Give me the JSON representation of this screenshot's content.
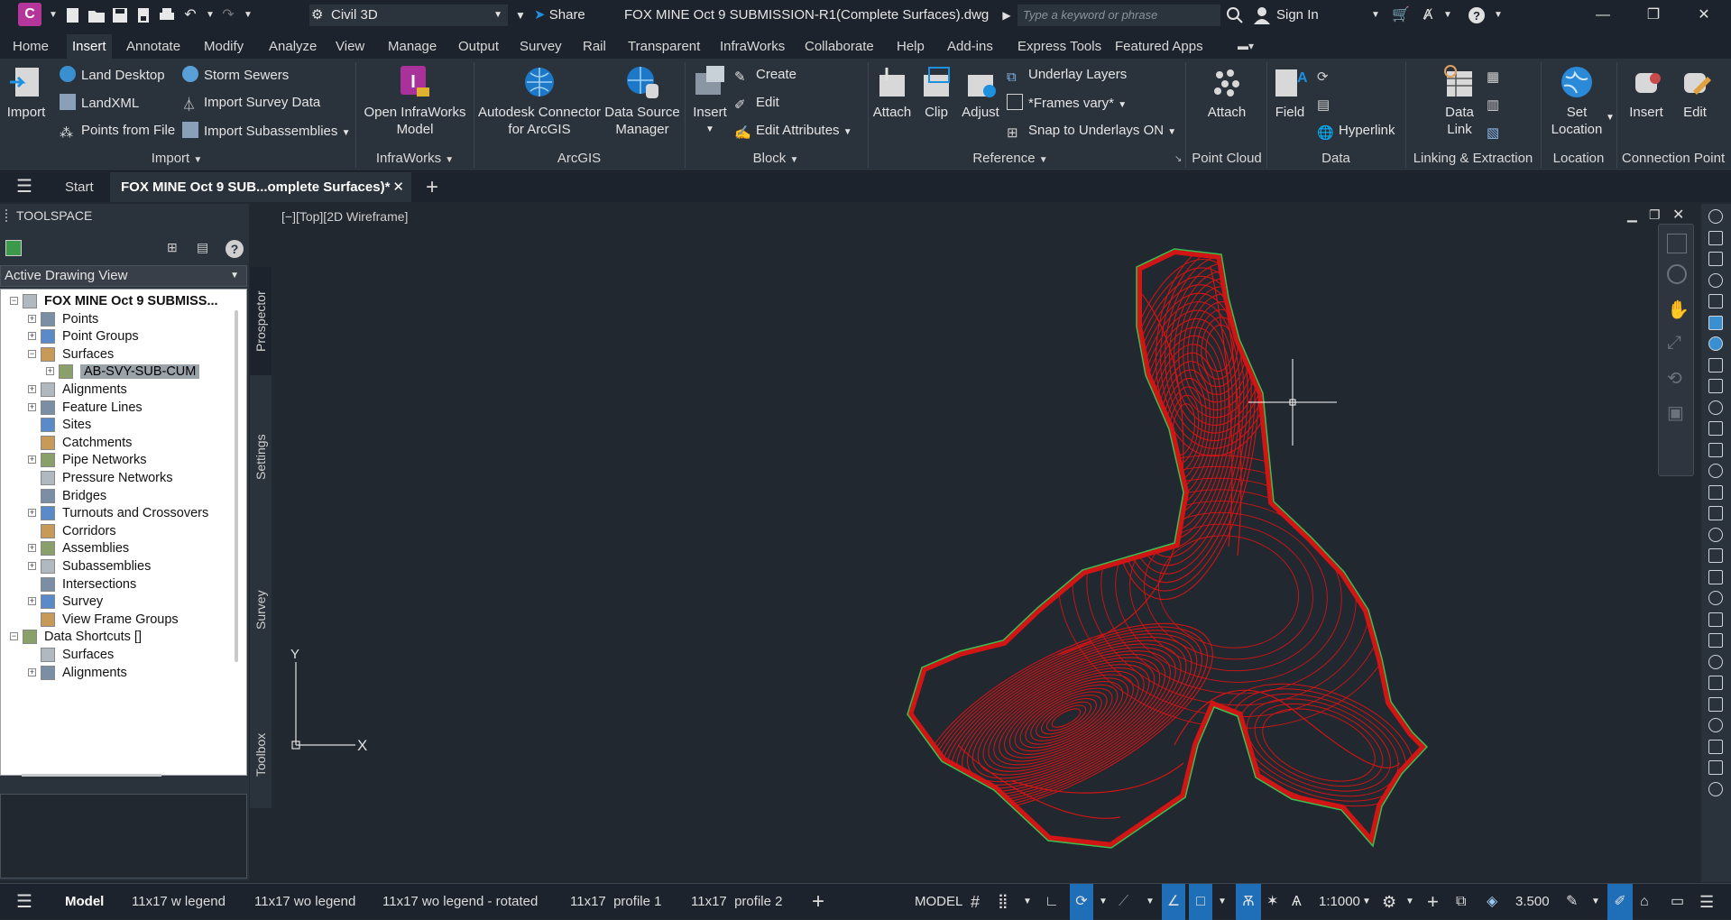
{
  "titlebar": {
    "app_letter": "C",
    "workspace": "Civil 3D",
    "share": "Share",
    "document_title": "FOX MINE Oct 9 SUBMISSION-R1(Complete Surfaces).dwg",
    "search_placeholder": "Type a keyword or phrase",
    "sign_in": "Sign In"
  },
  "menu": {
    "tabs": [
      "Home",
      "Insert",
      "Annotate",
      "Modify",
      "Analyze",
      "View",
      "Manage",
      "Output",
      "Survey",
      "Rail",
      "Transparent",
      "InfraWorks",
      "Collaborate",
      "Help",
      "Add-ins",
      "Express Tools",
      "Featured Apps"
    ],
    "active": "Insert"
  },
  "ribbon": {
    "import": {
      "title": "Import",
      "large": "Import",
      "items": [
        "Land Desktop",
        "LandXML",
        "Points from File",
        "Storm Sewers",
        "Import Survey Data",
        "Import Subassemblies"
      ]
    },
    "infraworks": {
      "title": "InfraWorks",
      "large_line1": "Open InfraWorks",
      "large_line2": "Model"
    },
    "arcgis": {
      "title": "ArcGIS",
      "connector_line1": "Autodesk Connector",
      "connector_line2": "for ArcGIS",
      "dsm_line1": "Data Source",
      "dsm_line2": "Manager"
    },
    "block": {
      "title": "Block",
      "large": "Insert",
      "items": [
        "Create",
        "Edit",
        "Edit Attributes"
      ]
    },
    "reference": {
      "title": "Reference",
      "attach": "Attach",
      "clip": "Clip",
      "adjust": "Adjust",
      "items": [
        "Underlay Layers",
        "*Frames vary*",
        "Snap to Underlays ON"
      ]
    },
    "pointcloud": {
      "title": "Point Cloud",
      "attach": "Attach"
    },
    "data": {
      "title": "Data",
      "field": "Field",
      "hyperlink": "Hyperlink"
    },
    "linking": {
      "title": "Linking & Extraction",
      "line1": "Data",
      "line2": "Link"
    },
    "location": {
      "title": "Location",
      "line1": "Set",
      "line2": "Location"
    },
    "connection": {
      "title": "Connection Point",
      "insert": "Insert",
      "edit": "Edit"
    }
  },
  "filetabs": {
    "start": "Start",
    "drawing": "FOX MINE Oct 9 SUB...omplete Surfaces)*"
  },
  "toolspace": {
    "title": "TOOLSPACE",
    "view_select": "Active Drawing View",
    "side_tabs": [
      "Prospector",
      "Settings",
      "Survey",
      "Toolbox"
    ],
    "tree": [
      {
        "label": "FOX MINE Oct 9 SUBMISS...",
        "level": 0,
        "exp": "-",
        "bold": true
      },
      {
        "label": "Points",
        "level": 1,
        "exp": "+"
      },
      {
        "label": "Point Groups",
        "level": 1,
        "exp": "+"
      },
      {
        "label": "Surfaces",
        "level": 1,
        "exp": "-"
      },
      {
        "label": "AB-SVY-SUB-CUM",
        "level": 2,
        "exp": "+",
        "selected": true
      },
      {
        "label": "Alignments",
        "level": 1,
        "exp": "+"
      },
      {
        "label": "Feature Lines",
        "level": 1,
        "exp": "+"
      },
      {
        "label": "Sites",
        "level": 1,
        "exp": ""
      },
      {
        "label": "Catchments",
        "level": 1,
        "exp": ""
      },
      {
        "label": "Pipe Networks",
        "level": 1,
        "exp": "+"
      },
      {
        "label": "Pressure Networks",
        "level": 1,
        "exp": ""
      },
      {
        "label": "Bridges",
        "level": 1,
        "exp": ""
      },
      {
        "label": "Turnouts and Crossovers",
        "level": 1,
        "exp": "+"
      },
      {
        "label": "Corridors",
        "level": 1,
        "exp": ""
      },
      {
        "label": "Assemblies",
        "level": 1,
        "exp": "+"
      },
      {
        "label": "Subassemblies",
        "level": 1,
        "exp": "+"
      },
      {
        "label": "Intersections",
        "level": 1,
        "exp": ""
      },
      {
        "label": "Survey",
        "level": 1,
        "exp": "+"
      },
      {
        "label": "View Frame Groups",
        "level": 1,
        "exp": ""
      },
      {
        "label": "Data Shortcuts []",
        "level": 0,
        "exp": "-"
      },
      {
        "label": "Surfaces",
        "level": 1,
        "exp": ""
      },
      {
        "label": "Alignments",
        "level": 1,
        "exp": "+"
      }
    ]
  },
  "viewport": {
    "label": "[−][Top][2D Wireframe]",
    "ucs_y": "Y",
    "ucs_x": "X"
  },
  "statusbar": {
    "layouts": [
      "Model",
      "11x17 w legend",
      "11x17 wo legend",
      "11x17 wo legend - rotated",
      "11x17  profile 1",
      "11x17  profile 2"
    ],
    "active_layout": "Model",
    "space": "MODEL",
    "scale": "1:1000",
    "value": "3.500"
  },
  "colors": {
    "contour": "#d11414",
    "boundary": "#35c050",
    "accent": "#1e90e0"
  }
}
